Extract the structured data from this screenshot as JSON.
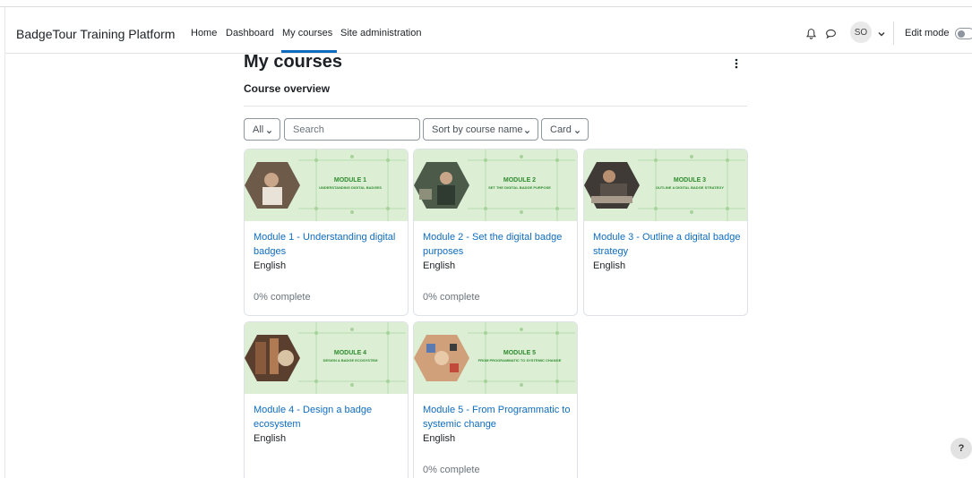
{
  "app": {
    "brand": "BadgeTour Training Platform"
  },
  "nav": {
    "links": [
      "Home",
      "Dashboard",
      "My courses",
      "Site administration"
    ],
    "active": "My courses"
  },
  "user": {
    "initials": "SO",
    "edit_mode_label": "Edit mode",
    "edit_mode_on": false
  },
  "page": {
    "title": "My courses",
    "section_title": "Course overview"
  },
  "filters": {
    "grouping": "All",
    "search_placeholder": "Search",
    "sort": "Sort by course name",
    "view": "Card"
  },
  "courses": [
    {
      "title": "Module 1 - Understanding digital badges",
      "language": "English",
      "progress": "0% complete",
      "banner_heading": "MODULE 1",
      "banner_sub": "UNDERSTANDING DIGITAL BADGES"
    },
    {
      "title": "Module 2 - Set the digital badge purposes",
      "language": "English",
      "progress": "0% complete",
      "banner_heading": "MODULE 2",
      "banner_sub": "SET THE DIGITAL BADGE PURPOSE"
    },
    {
      "title": "Module 3 - Outline a digital badge strategy",
      "language": "English",
      "progress": "",
      "banner_heading": "MODULE 3",
      "banner_sub": "OUTLINE A DIGITAL BADGE STRATEGY"
    },
    {
      "title": "Module 4 - Design a badge ecosystem",
      "language": "English",
      "progress": "",
      "banner_heading": "MODULE 4",
      "banner_sub": "DESIGN A BADGE ECOSYSTEM"
    },
    {
      "title": "Module 5 - From Programmatic to systemic change",
      "language": "English",
      "progress": "0% complete",
      "banner_heading": "MODULE 5",
      "banner_sub": "FROM PROGRAMMATIC TO SYSTEMIC CHANGE"
    }
  ],
  "help": {
    "label": "?"
  },
  "colors": {
    "link": "#0f6cbf",
    "card_banner": "#dcefd5",
    "banner_text": "#2e8b2e"
  }
}
